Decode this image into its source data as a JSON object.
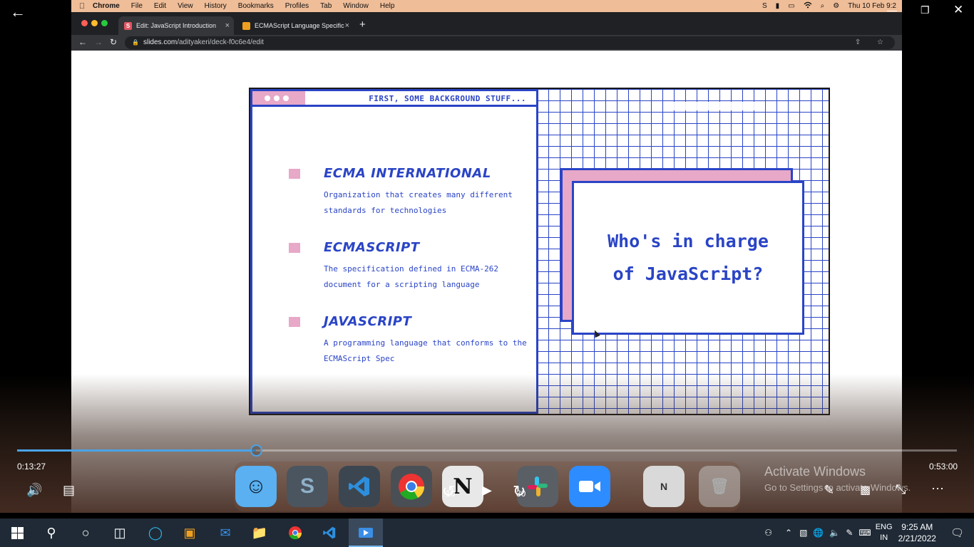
{
  "mac_menu": {
    "apple": "",
    "items": [
      "Chrome",
      "File",
      "Edit",
      "View",
      "History",
      "Bookmarks",
      "Profiles",
      "Tab",
      "Window",
      "Help"
    ],
    "clock": "Thu 10 Feb 9:2",
    "status_icons": [
      "S",
      "▮",
      "▭",
      "wifi",
      "⌕",
      "⚙"
    ]
  },
  "browser": {
    "tabs": [
      {
        "label": "Edit: JavaScript Introduction",
        "favicon": "S",
        "favicon_color": "#e05561"
      },
      {
        "label": "ECMAScript Language Specific",
        "favicon": "■",
        "favicon_color": "#f0a020"
      }
    ],
    "new_tab": "+",
    "close": "×",
    "url_host": "slides.com",
    "url_path": "/adityakeri/deck-f0c6e4/edit",
    "url_actions": "⇧ ☆"
  },
  "slide": {
    "heading": "FIRST, SOME BACKGROUND STUFF...",
    "items": [
      {
        "title": "ECMA INTERNATIONAL",
        "desc": "Organization that creates many different standards for technologies"
      },
      {
        "title": "ECMASCRIPT",
        "desc": "The specification defined in ECMA-262 document for a scripting language"
      },
      {
        "title": "JAVASCRIPT",
        "desc": "A programming language that conforms to the ECMAScript Spec"
      }
    ],
    "card_text": "Who's in charge of JavaScript?",
    "colors": {
      "blue": "#2a44c6",
      "pink": "#e8a8c8"
    }
  },
  "player": {
    "current_time": "0:13:27",
    "total_time": "0:53:00",
    "progress": 0.2538,
    "skip_back": "10",
    "skip_forward": "30",
    "controls": [
      "volume-icon",
      "captions-icon",
      "play-icon",
      "pen-icon",
      "mini-view-icon",
      "fullscreen-icon",
      "more-icon"
    ]
  },
  "dock": {
    "apps": [
      "Finder",
      "Sublime",
      "VS Code",
      "Chrome",
      "Notion",
      "Slack",
      "Zoom",
      "Preview",
      "Trash"
    ]
  },
  "watermark": {
    "line1": "Activate Windows",
    "line2": "Go to Settings to activate Windows."
  },
  "taskbar": {
    "lang_top": "ENG",
    "lang_bottom": "IN",
    "time": "9:25 AM",
    "date": "2/21/2022"
  }
}
